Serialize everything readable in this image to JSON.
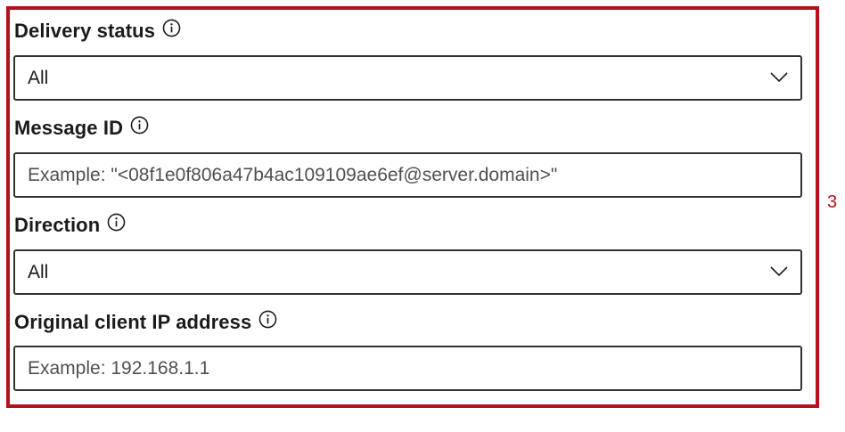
{
  "form": {
    "delivery_status": {
      "label": "Delivery status",
      "selected": "All"
    },
    "message_id": {
      "label": "Message ID",
      "placeholder": "Example: \"<08f1e0f806a47b4ac109109ae6ef@server.domain>\""
    },
    "direction": {
      "label": "Direction",
      "selected": "All"
    },
    "client_ip": {
      "label": "Original client IP address",
      "placeholder": "Example: 192.168.1.1"
    }
  },
  "callout": {
    "number": "3",
    "color": "#b3121b"
  },
  "icons": {
    "info": "info-icon",
    "dropdown": "chevron-down-icon"
  }
}
